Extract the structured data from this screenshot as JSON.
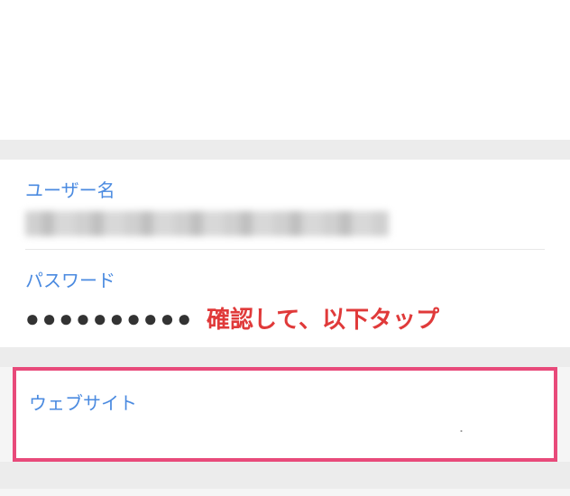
{
  "fields": {
    "username": {
      "label": "ユーザー名",
      "value_obscured": true
    },
    "password": {
      "label": "パスワード",
      "masked_value": "●●●●●●●●●●"
    },
    "website": {
      "label": "ウェブサイト"
    }
  },
  "annotation": {
    "text": "確認して、以下タップ",
    "color": "#e03a3a"
  }
}
